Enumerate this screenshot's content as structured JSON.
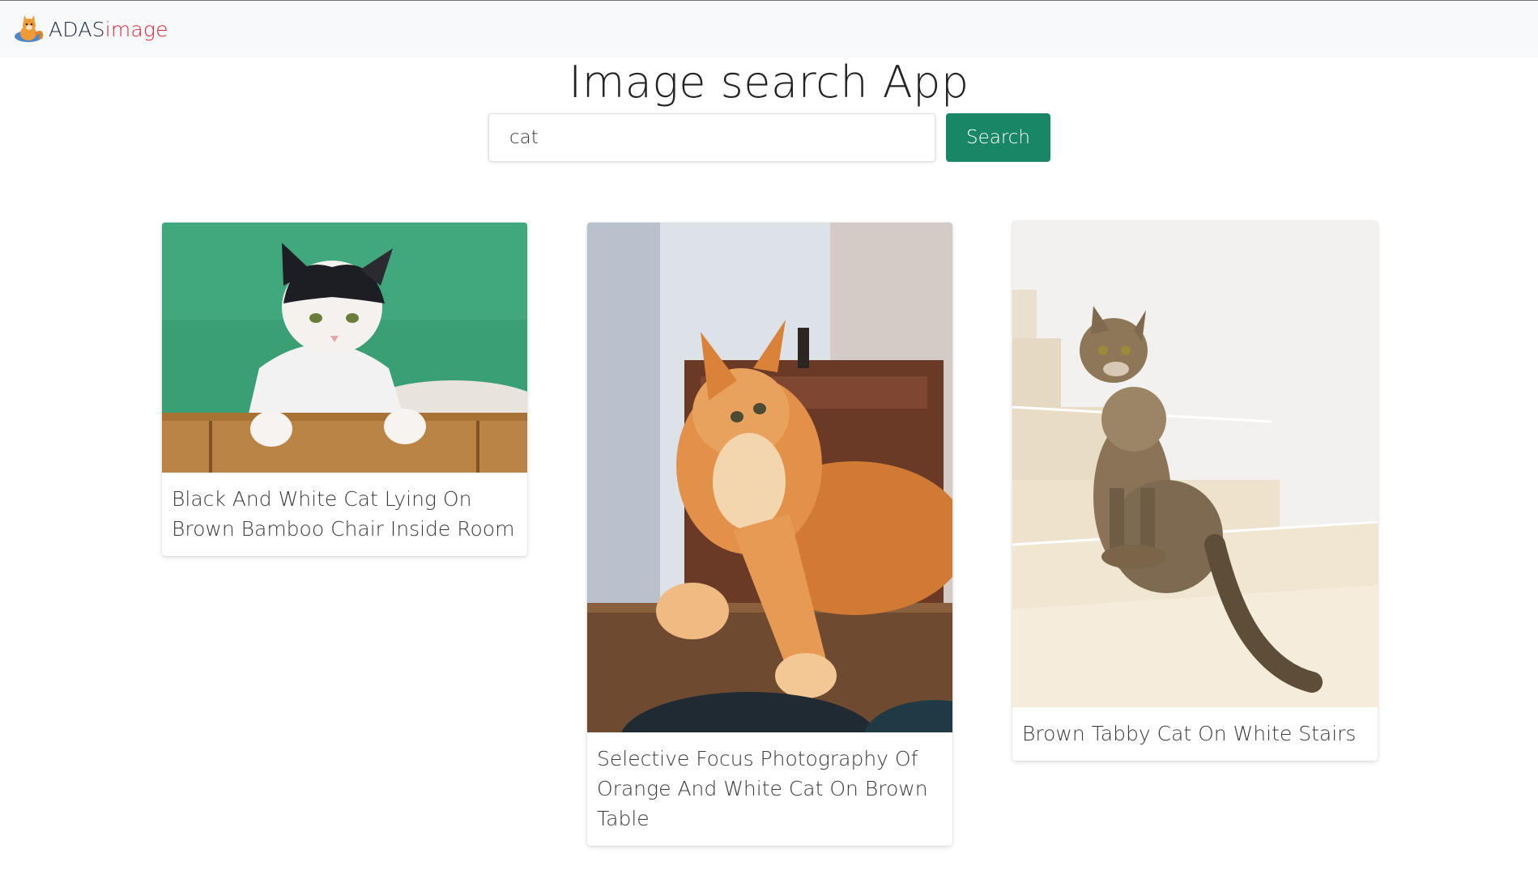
{
  "brand": {
    "part1": "ADAS",
    "part2": "image"
  },
  "title": "Image search App",
  "search": {
    "value": "cat",
    "button_label": "Search"
  },
  "results": [
    {
      "title": "Black And White Cat Lying On Brown Bamboo Chair Inside Room",
      "image_icon": "black-white-cat-image"
    },
    {
      "title": "Selective Focus Photography Of Orange And White Cat On Brown Table",
      "image_icon": "orange-cat-image"
    },
    {
      "title": "Brown Tabby Cat On White Stairs",
      "image_icon": "tabby-cat-image"
    }
  ],
  "colors": {
    "accent": "#198766",
    "brand_dark": "#1f2a44",
    "brand_red": "#d6283b",
    "navbar_bg": "#f8f9fa"
  }
}
